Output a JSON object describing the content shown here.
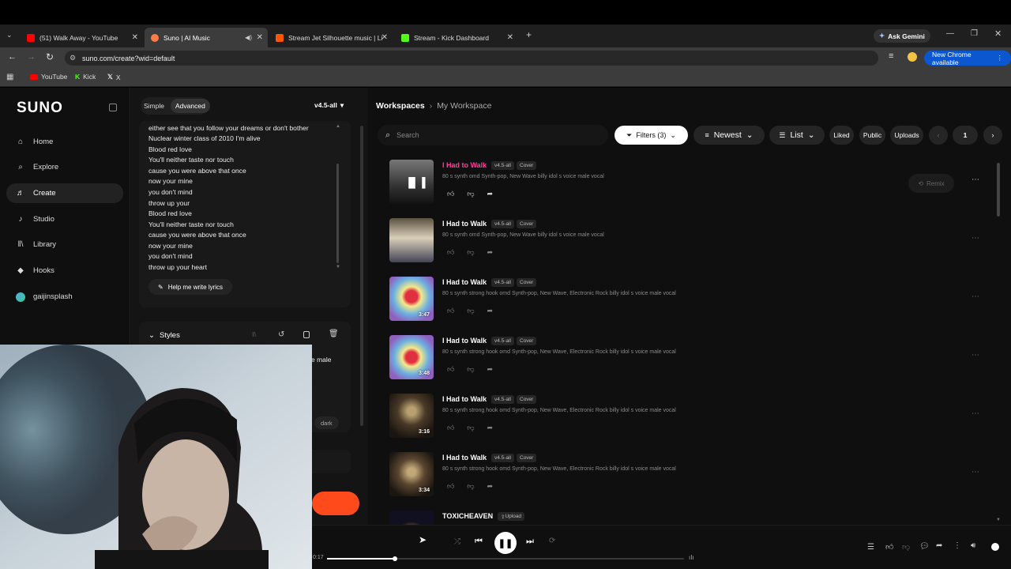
{
  "browser": {
    "tabs": [
      {
        "title": "(51) Walk Away - YouTube",
        "color": "#ff0000"
      },
      {
        "title": "Suno | AI Music",
        "color": "#ff7a45"
      },
      {
        "title": "Stream Jet Silhouette music | Li",
        "color": "#ff5500"
      },
      {
        "title": "Stream - Kick Dashboard",
        "color": "#53fc18"
      }
    ],
    "ask_gemini": "Ask Gemini",
    "url": "suno.com/create?wid=default",
    "new_chrome": "New Chrome available",
    "bookmarks": [
      "YouTube",
      "Kick",
      "X"
    ]
  },
  "sidebar": {
    "logo": "SUNO",
    "items": [
      {
        "label": "Home",
        "icon": "home-icon"
      },
      {
        "label": "Explore",
        "icon": "compass-icon"
      },
      {
        "label": "Create",
        "icon": "music-note-icon"
      },
      {
        "label": "Studio",
        "icon": "music-note-icon"
      },
      {
        "label": "Library",
        "icon": "library-icon"
      },
      {
        "label": "Hooks",
        "icon": "hook-icon"
      },
      {
        "label": "gaijinsplash",
        "icon": "avatar"
      }
    ]
  },
  "creator": {
    "mode_simple": "Simple",
    "mode_advanced": "Advanced",
    "version": "v4.5-all",
    "lyrics": [
      "either see that you follow your dreams or don't bother",
      "Nuclear winter class of 2010 I'm alive",
      "Blood red love",
      "You'll neither taste nor touch",
      "cause you were above that once",
      "now your mine",
      "you don't mind",
      "throw up your",
      "Blood red love",
      "You'll neither taste nor touch",
      "cause you were above that once",
      "now your mine",
      "you don't mind",
      "throw up your heart"
    ],
    "help_lyrics": "Help me write lyrics",
    "styles_label": "Styles",
    "styles_snippet": "e male",
    "styles_tag": "dark"
  },
  "workspace": {
    "breadcrumb_root": "Workspaces",
    "breadcrumb_current": "My Workspace",
    "search_placeholder": "Search",
    "filters": "Filters (3)",
    "sort": "Newest",
    "view": "List",
    "liked": "Liked",
    "public": "Public",
    "uploads": "Uploads",
    "page": "1",
    "remix": "Remix",
    "songs": [
      {
        "title": "I Had to Walk",
        "version": "v4.5-all",
        "tag": "Cover",
        "desc": "80 s synth omd Synth-pop, New Wave billy idol s voice male vocal",
        "duration": "",
        "highlight": true
      },
      {
        "title": "I Had to Walk",
        "version": "v4.5-all",
        "tag": "Cover",
        "desc": "80 s synth omd Synth-pop, New Wave billy idol s voice male vocal",
        "duration": "",
        "highlight": false
      },
      {
        "title": "I Had to Walk",
        "version": "v4.5-all",
        "tag": "Cover",
        "desc": "80 s synth strong hook omd Synth-pop, New Wave, Electronic Rock billy idol s voice male vocal",
        "duration": "3:47",
        "highlight": false
      },
      {
        "title": "I Had to Walk",
        "version": "v4.5-all",
        "tag": "Cover",
        "desc": "80 s synth strong hook omd Synth-pop, New Wave, Electronic Rock billy idol s voice male vocal",
        "duration": "3:48",
        "highlight": false
      },
      {
        "title": "I Had to Walk",
        "version": "v4.5-all",
        "tag": "Cover",
        "desc": "80 s synth strong hook omd Synth-pop, New Wave, Electronic Rock billy idol s voice male vocal",
        "duration": "3:16",
        "highlight": false
      },
      {
        "title": "I Had to Walk",
        "version": "v4.5-all",
        "tag": "Cover",
        "desc": "80 s synth strong hook omd Synth-pop, New Wave, Electronic Rock billy idol s voice male vocal",
        "duration": "3:34",
        "highlight": false
      },
      {
        "title": "TOXICHEAVEN",
        "version": "",
        "tag": "Upload",
        "desc": "",
        "duration": "",
        "highlight": false
      }
    ]
  },
  "player": {
    "time": "0:17",
    "progress": 0.19
  },
  "colors": {
    "accent_pink": "#ff3d9a",
    "create_orange": "#ff4a1c"
  }
}
